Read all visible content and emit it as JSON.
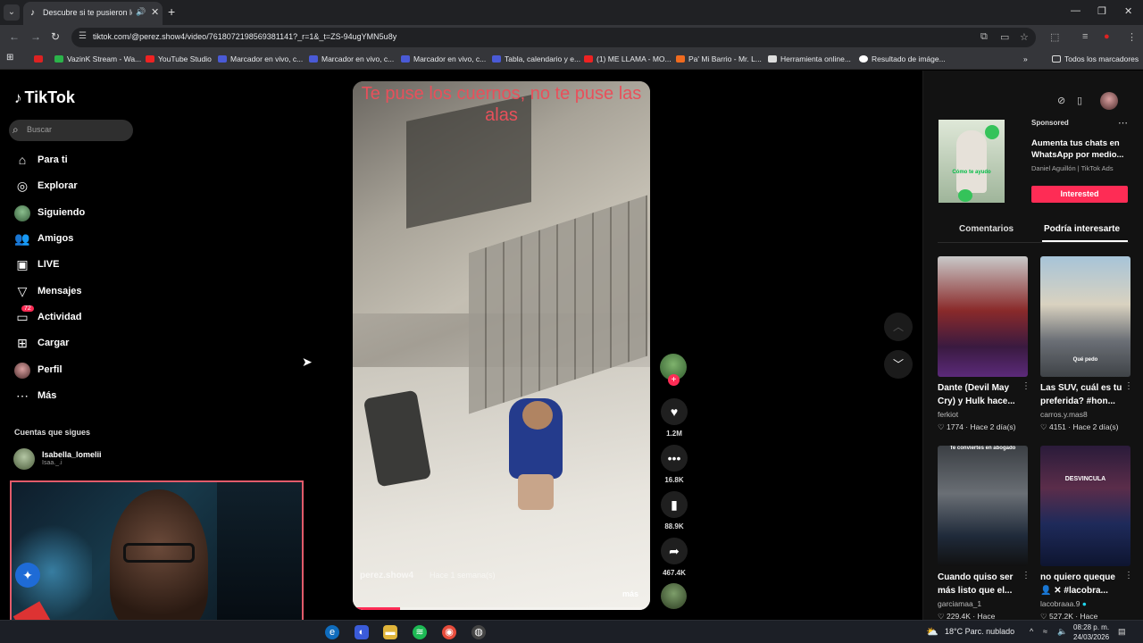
{
  "browser": {
    "tab_title": "Descubre si te pusieron los",
    "url": "tiktok.com/@perez.show4/video/7618072198569381141?_r=1&_t=ZS-94ugYMN5u8y",
    "bookmarks": [
      {
        "label": "",
        "color": "#d22"
      },
      {
        "label": "VazinK Stream - Wa...",
        "color": "#2bb34a"
      },
      {
        "label": "YouTube Studio",
        "color": "#e22"
      },
      {
        "label": "Marcador en vivo, c...",
        "color": "#4a5ad6"
      },
      {
        "label": "Marcador en vivo, c...",
        "color": "#4a5ad6"
      },
      {
        "label": "Marcador en vivo, c...",
        "color": "#4a5ad6"
      },
      {
        "label": "Tabla, calendario y e...",
        "color": "#4a5ad6"
      },
      {
        "label": "(1) ME LLAMA - MO...",
        "color": "#e22"
      },
      {
        "label": "Pa' Mi Barrio - Mr. L...",
        "color": "#f06b1f"
      },
      {
        "label": "Herramienta online...",
        "color": "#ddd"
      },
      {
        "label": "Resultado de imáge...",
        "color": "#fff"
      }
    ],
    "all_bookmarks": "Todos los marcadores"
  },
  "sidebar": {
    "logo": "TikTok",
    "search_placeholder": "Buscar",
    "items": [
      {
        "label": "Para ti",
        "icon": "home-icon"
      },
      {
        "label": "Explorar",
        "icon": "compass-icon"
      },
      {
        "label": "Siguiendo",
        "icon": "following-avatar-icon"
      },
      {
        "label": "Amigos",
        "icon": "friends-icon"
      },
      {
        "label": "LIVE",
        "icon": "live-icon"
      },
      {
        "label": "Mensajes",
        "icon": "messages-icon"
      },
      {
        "label": "Actividad",
        "icon": "activity-icon"
      },
      {
        "label": "Cargar",
        "icon": "upload-icon"
      },
      {
        "label": "Perfil",
        "icon": "profile-avatar-icon"
      },
      {
        "label": "Más",
        "icon": "more-icon"
      }
    ],
    "activity_badge": "72",
    "following_heading": "Cuentas que sigues",
    "following": [
      {
        "name": "Isabella_lomelii",
        "sub": "Isaa._.i"
      }
    ]
  },
  "video": {
    "caption": "Te puse los cuernos, no te puse las alas",
    "author": "perez.show4",
    "time": "Hace 1 semana(s)",
    "more": "más",
    "progress": 0.16
  },
  "actions": {
    "likes": "1.2M",
    "comments": "16.8K",
    "saves": "88.9K",
    "shares": "467.4K"
  },
  "right_panel": {
    "ad": {
      "sponsored": "Sponsored",
      "text": "Aumenta tus chats en WhatsApp por medio...",
      "author": "Daniel Aguillón | TikTok Ads",
      "button": "Interested",
      "thumb_text": "Cómo te ayudo"
    },
    "tabs": [
      "Comentarios",
      "Podría interesarte"
    ],
    "cards": [
      {
        "title": "Dante (Devil May Cry) y Hulk hace...",
        "author": "ferkiot",
        "likes": "1774",
        "time": "Hace 2 día(s)"
      },
      {
        "title": "Las SUV, cuál es tu preferida? #hon...",
        "author": "carros.y.mas8",
        "likes": "4151",
        "time": "Hace 2 día(s)",
        "thumb_text": "Qué pedo"
      },
      {
        "title": "Cuando quiso ser más listo que el...",
        "author": "garciamaa_1",
        "likes": "229.4K",
        "time": "Hace",
        "thumb_text": "Te conviertes en abogado"
      },
      {
        "title": "no quiero queque 👤 ✕ #lacobra...",
        "author": "lacobraaa.9",
        "likes": "527.2K",
        "time": "Hace",
        "thumb_text": "DESVINCULA"
      }
    ]
  },
  "taskbar": {
    "weather": "18°C  Parc. nublado",
    "time": "08:28 p. m.",
    "date": "24/03/2026"
  }
}
